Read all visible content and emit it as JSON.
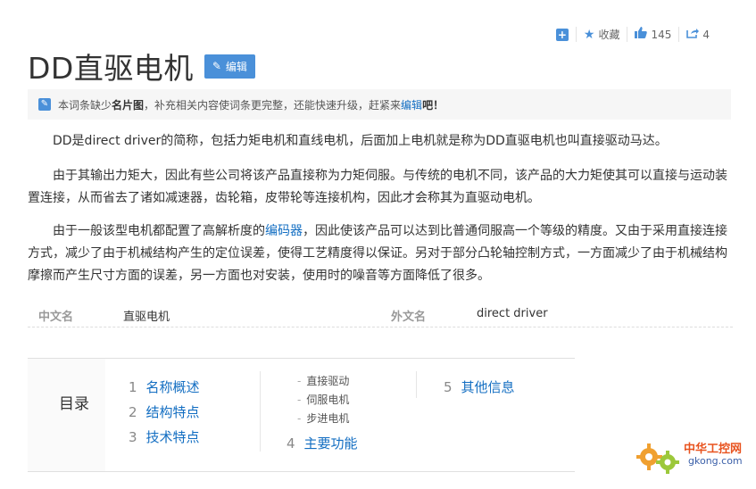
{
  "actions": {
    "favorite_label": "收藏",
    "like_count": "145",
    "share_count": "4"
  },
  "title": "DD直驱电机",
  "edit_label": "编辑",
  "notice": {
    "prefix": "本词条缺少",
    "bold": "名片图",
    "middle": "，补充相关内容使词条更完整，还能快速升级，赶紧来",
    "link": "编辑",
    "suffix": "吧！"
  },
  "paragraphs": {
    "p1": "DD是direct driver的简称，包括力矩电机和直线电机，后面加上电机就是称为DD直驱电机也叫直接驱动马达。",
    "p2": "由于其输出力矩大，因此有些公司将该产品直接称为力矩伺服。与传统的电机不同，该产品的大力矩使其可以直接与运动装置连接，从而省去了诸如减速器，齿轮箱，皮带轮等连接机构，因此才会称其为直驱动电机。",
    "p3_a": "由于一般该型电机都配置了高解析度的",
    "p3_link": "编码器",
    "p3_b": "，因此使该产品可以达到比普通伺服高一个等级的精度。又由于采用直接连接方式，减少了由于机械结构产生的定位误差，使得工艺精度得以保证。另对于部分凸轮轴控制方式，一方面减少了由于机械结构摩擦而产生尺寸方面的误差，另一方面也对安装，使用时的噪音等方面降低了很多。"
  },
  "basic_info": {
    "k1": "中文名",
    "v1": "直驱电机",
    "k2": "外文名",
    "v2": "direct driver"
  },
  "catalog": {
    "title": "目录",
    "items": [
      {
        "num": "1",
        "label": "名称概述"
      },
      {
        "num": "2",
        "label": "结构特点"
      },
      {
        "num": "3",
        "label": "技术特点"
      },
      {
        "num": "4",
        "label": "主要功能"
      },
      {
        "num": "5",
        "label": "其他信息"
      }
    ],
    "sub_items": [
      "直接驱动",
      "伺服电机",
      "步进电机"
    ]
  },
  "watermark": {
    "name": "中华工控网",
    "domain": "gkong.com"
  },
  "colors": {
    "accent": "#4a90d9",
    "link": "#136ec2"
  }
}
